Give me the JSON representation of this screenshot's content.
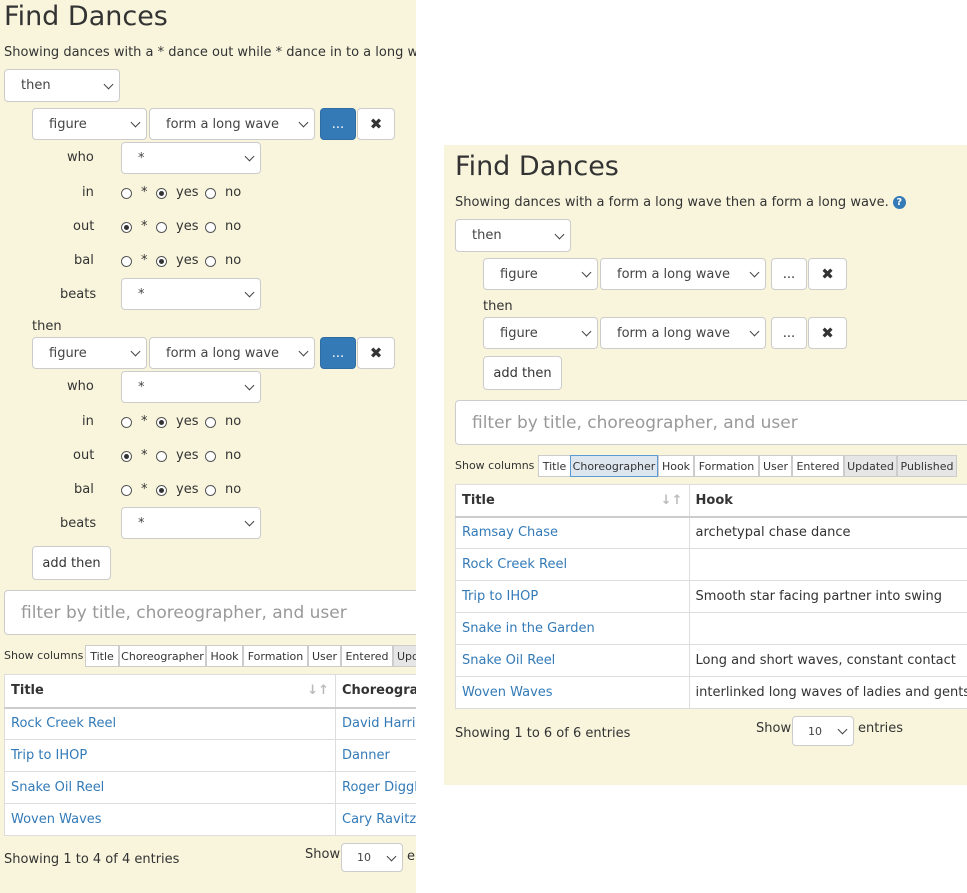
{
  "left": {
    "title": "Find Dances",
    "summary": "Showing dances with a * dance out while * dance in to a long wave in",
    "root_select": "then",
    "figures": [
      {
        "kind": "figure",
        "move": "form a long wave",
        "more": "...",
        "remove": "✖",
        "who_label": "who",
        "who": "*",
        "in_label": "in",
        "out_label": "out",
        "bal_label": "bal",
        "beats_label": "beats",
        "beats": "*",
        "opt_star": "*",
        "opt_yes": "yes",
        "opt_no": "no",
        "in_value": "yes",
        "out_value": "*",
        "bal_value": "yes"
      },
      {
        "kind": "figure",
        "move": "form a long wave",
        "more": "...",
        "remove": "✖",
        "who_label": "who",
        "who": "*",
        "in_label": "in",
        "out_label": "out",
        "bal_label": "bal",
        "beats_label": "beats",
        "beats": "*",
        "opt_star": "*",
        "opt_yes": "yes",
        "opt_no": "no",
        "in_value": "yes",
        "out_value": "*",
        "bal_value": "yes"
      }
    ],
    "then_label": "then",
    "add_then": "add then",
    "filter_placeholder": "filter by title, choreographer, and user",
    "show_columns_label": "Show columns",
    "column_toggles": [
      "Title",
      "Choreographer",
      "Hook",
      "Formation",
      "User",
      "Entered",
      "Upd"
    ],
    "table": {
      "headers": [
        "Title",
        "Choreograph"
      ],
      "rows": [
        [
          "Rock Creek Reel",
          "David Harris"
        ],
        [
          "Trip to IHOP",
          "Danner"
        ],
        [
          "Snake Oil Reel",
          "Roger Diggle"
        ],
        [
          "Woven Waves",
          "Cary Ravitz"
        ]
      ]
    },
    "info": "Showing 1 to 4 of 4 entries",
    "show_label": "Show",
    "length": "10",
    "entries_label": "en"
  },
  "right": {
    "title": "Find Dances",
    "summary": "Showing dances with a form a long wave then a form a long wave.",
    "help_icon": "?",
    "root_select": "then",
    "figures": [
      {
        "kind": "figure",
        "move": "form a long wave",
        "more": "...",
        "remove": "✖"
      },
      {
        "kind": "figure",
        "move": "form a long wave",
        "more": "...",
        "remove": "✖"
      }
    ],
    "then_label": "then",
    "add_then": "add then",
    "filter_placeholder": "filter by title, choreographer, and user",
    "show_columns_label": "Show columns",
    "column_toggles": [
      "Title",
      "Choreographer",
      "Hook",
      "Formation",
      "User",
      "Entered",
      "Updated",
      "Published"
    ],
    "table": {
      "headers": [
        "Title",
        "Hook"
      ],
      "rows": [
        [
          "Ramsay Chase",
          "archetypal chase dance"
        ],
        [
          "Rock Creek Reel",
          ""
        ],
        [
          "Trip to IHOP",
          "Smooth star facing partner into swing"
        ],
        [
          "Snake in the Garden",
          ""
        ],
        [
          "Snake Oil Reel",
          "Long and short waves, constant contact"
        ],
        [
          "Woven Waves",
          "interlinked long waves of ladies and gents"
        ]
      ]
    },
    "info": "Showing 1 to 6 of 6 entries",
    "show_label": "Show",
    "length": "10",
    "entries_label": "entries"
  },
  "colors": {
    "panel_bg": "#f8f5dc",
    "link": "#337ab7",
    "primary_button": "#337ab7"
  }
}
